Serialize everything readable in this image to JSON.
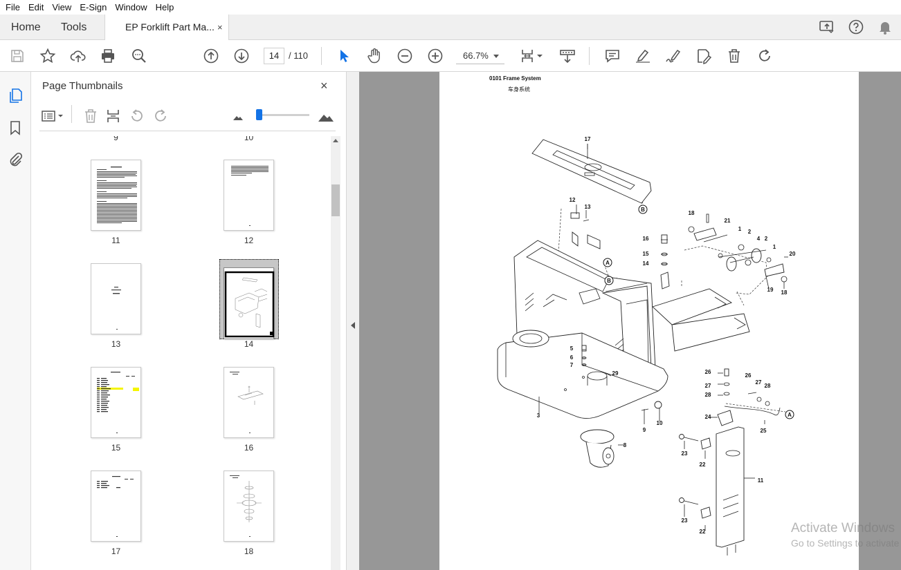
{
  "menu": [
    "File",
    "Edit",
    "View",
    "E-Sign",
    "Window",
    "Help"
  ],
  "tabs": {
    "home": "Home",
    "tools": "Tools",
    "document": "EP Forklift Part Ma...",
    "close": "×"
  },
  "toolbar": {
    "current_page": "14",
    "total_pages": "/ 110",
    "zoom": "66.7%"
  },
  "panel": {
    "title": "Page Thumbnails",
    "close": "×",
    "partial_top": [
      "9",
      "10"
    ],
    "thumbnails": [
      {
        "label": "11"
      },
      {
        "label": "12"
      },
      {
        "label": "13"
      },
      {
        "label": "14",
        "selected": true
      },
      {
        "label": "15"
      },
      {
        "label": "16"
      },
      {
        "label": "17"
      },
      {
        "label": "18"
      }
    ]
  },
  "document_page": {
    "heading": "0101 Frame System",
    "subheading": "车身系统",
    "callouts": [
      "17",
      "12",
      "13",
      "16",
      "15",
      "14",
      "18",
      "21",
      "1",
      "2",
      "4",
      "2",
      "1",
      "20",
      "19",
      "18",
      "5",
      "6",
      "7",
      "29",
      "3",
      "8",
      "9",
      "10",
      "26",
      "27",
      "28",
      "26",
      "27",
      "28",
      "24",
      "25",
      "23",
      "22",
      "11",
      "23",
      "22"
    ],
    "reference_marks": [
      "A",
      "B",
      "B",
      "A"
    ]
  },
  "watermark": {
    "line1": "Activate Windows",
    "line2": "Go to Settings to activate Windows."
  },
  "colors": {
    "accent": "#1473e6",
    "viewer_bg": "#979797",
    "highlight": "#f5f500"
  }
}
